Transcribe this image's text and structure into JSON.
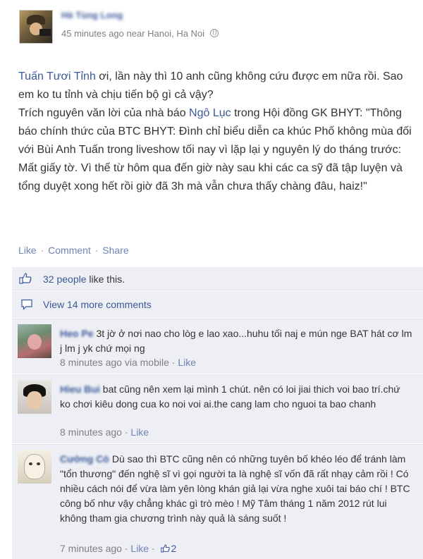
{
  "post": {
    "author": "Hà Tùng Long",
    "meta": "45 minutes ago near Hanoi, Ha Noi",
    "body": {
      "mention1": "Tuấn Tươi Tỉnh",
      "line1_rest": " ơi, lần này thì 10 anh cũng không cứu được em nữa rồi. Sao em ko tu tỉnh và chịu tiến bộ gì cả vậy?",
      "line2_start": "Trích nguyên văn lời của nhà báo ",
      "mention2": "Ngô Lục",
      "line2_rest": " trong Hội đồng GK BHYT: \"Thông báo chính thức của BTC BHYT: Đình chỉ biểu diễn ca khúc Phố không mùa đối với Bùi Anh Tuấn trong liveshow tối nay vì lặp lại y nguyên lý do tháng trước: Mất giấy tờ. Vì thế từ hôm qua đến giờ này sau khi các ca sỹ đã tập luyện và tổng duyệt xong hết rồi giờ đã 3h mà vẫn chưa thấy chàng đâu, haiz!\""
    },
    "actions": {
      "like": "Like",
      "comment": "Comment",
      "share": "Share",
      "sep": "·"
    }
  },
  "likes": {
    "count": "32 people",
    "rest": " like this."
  },
  "view_more": "View 14 more comments",
  "comments": [
    {
      "author": "Heo Pe",
      "text": "3t jờ ở nơi nao cho lòg e lao xao...huhu tối naj e mún nge BAT hát cơ lm j lm j yk chứ mọi ng",
      "time": "8 minutes ago via mobile",
      "like": "Like"
    },
    {
      "author": "Hieu Bui",
      "text": "bat cũng nên xem lại mình 1 chút. nên có loi jiai thich voi bao trí.chứ ko chơi kiêu dong cua ko noi voi ai.the cang lam cho nguoi ta bao chanh",
      "time": "8 minutes ago",
      "like": "Like"
    },
    {
      "author": "Cường Cò",
      "text": "Dù sao thì BTC cũng nên có những tuyên bố khéo léo để tránh làm \"tổn thương\" đến nghệ sĩ vì gọi người ta là nghệ sĩ vốn đã rất nhạy cảm rồi ! Có nhiều cách nói để vừa làm yên lòng khán giả lại vừa nghe xuôi tai báo chí ! BTC công bố như vậy chẳng khác gì trò mèo ! Mỹ Tâm tháng 1 năm 2012 rút lui không tham gia chương trình này quả là sáng suốt !",
      "time": "7 minutes ago",
      "like": "Like",
      "like_count": "2"
    }
  ],
  "colors": {
    "link": "#3b5998",
    "ufi_bg": "#edeff4",
    "meta": "#808080"
  }
}
